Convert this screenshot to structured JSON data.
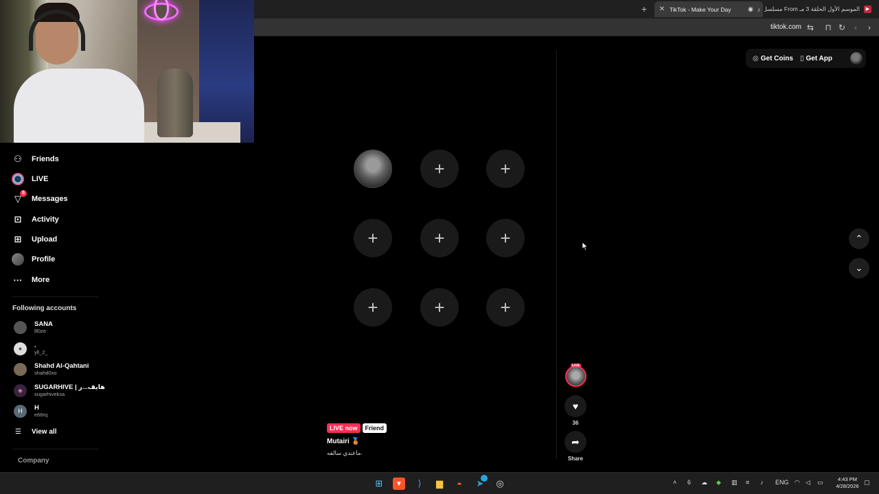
{
  "browser": {
    "active_tab_title": "TikTok - Make Your Day",
    "other_tab_title": "مسلسل From الموسم الأول الحلقة 3 مـ",
    "url": "tiktok.com"
  },
  "sidebar": {
    "items": [
      {
        "label": "Friends",
        "icon": "friends-icon"
      },
      {
        "label": "LIVE",
        "icon": "live-icon"
      },
      {
        "label": "Messages",
        "icon": "messages-icon",
        "badge": "5"
      },
      {
        "label": "Activity",
        "icon": "activity-icon"
      },
      {
        "label": "Upload",
        "icon": "upload-icon"
      },
      {
        "label": "Profile",
        "icon": "profile-icon"
      },
      {
        "label": "More",
        "icon": "more-icon"
      }
    ],
    "following_title": "Following accounts",
    "following": [
      {
        "name": "SANA",
        "username": "lll0ze"
      },
      {
        "name": ".",
        "username": "yll_2_"
      },
      {
        "name": "Shahd Al-Qahtani",
        "username": "shahd0xo"
      },
      {
        "name": "SUGARHIVE | هايف...ر",
        "username": "sugarhiveksa"
      },
      {
        "name": "H",
        "username": "e66rq",
        "initial": "H"
      }
    ],
    "view_all": "View all",
    "company": "Company"
  },
  "header": {
    "get_coins": "Get Coins",
    "get_app": "Get App"
  },
  "live": {
    "live_badge": "LIVE now",
    "friend_badge": "Friend",
    "host": "Mutairi 🥉",
    "caption": "ماعندي سالفه.",
    "like_count": "36",
    "share_label": "Share",
    "live_mini": "LIVE"
  },
  "taskbar": {
    "lang": "ENG",
    "time": "4:43 PM",
    "date": "4/28/2026",
    "telegram_badge": "3"
  },
  "colors": {
    "accent": "#fe2c55",
    "background": "#000000",
    "cell": "#1a1a1a"
  }
}
